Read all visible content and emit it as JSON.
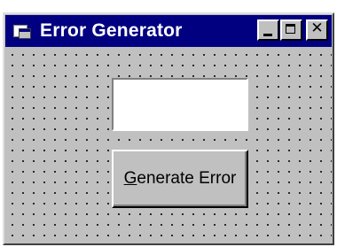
{
  "window": {
    "title": "Error Generator",
    "icon": "form-icon"
  },
  "caption_buttons": {
    "minimize_icon": "minimize-icon",
    "maximize_icon": "maximize-icon",
    "close_icon": "close-icon",
    "close_glyph": "✕"
  },
  "form": {
    "textbox_value": "",
    "button": {
      "mnemonic": "G",
      "rest": "enerate Error"
    }
  },
  "colors": {
    "titlebar": "#000080",
    "face": "#c0c0c0"
  }
}
